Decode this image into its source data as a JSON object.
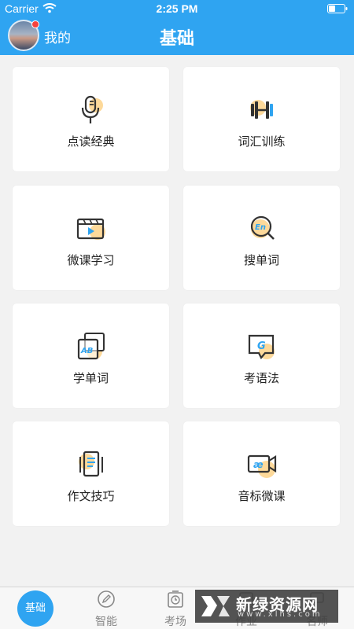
{
  "status_bar": {
    "carrier": "Carrier",
    "time": "2:25 PM"
  },
  "header": {
    "my_label": "我的",
    "title": "基础"
  },
  "cards": [
    {
      "label": "点读经典",
      "icon": "microphone-icon"
    },
    {
      "label": "词汇训练",
      "icon": "dumbbell-icon"
    },
    {
      "label": "微课学习",
      "icon": "video-player-icon"
    },
    {
      "label": "搜单词",
      "icon": "search-en-icon"
    },
    {
      "label": "学单词",
      "icon": "ab-cards-icon"
    },
    {
      "label": "考语法",
      "icon": "g-chat-icon"
    },
    {
      "label": "作文技巧",
      "icon": "document-icon"
    },
    {
      "label": "音标微课",
      "icon": "phonetic-camera-icon"
    }
  ],
  "tabbar": {
    "active": "基础",
    "tabs": [
      {
        "label": "智能",
        "icon": "pencil-circle-icon"
      },
      {
        "label": "考场",
        "icon": "clock-board-icon"
      },
      {
        "label": "作业",
        "icon": "homework-icon"
      },
      {
        "label": "名师",
        "icon": "teacher-icon"
      }
    ]
  },
  "watermark": {
    "text": "新绿资源网",
    "url": "www.xlhs.com"
  },
  "colors": {
    "primary": "#2fa4f1",
    "accent": "#fdd99a",
    "icon_stroke": "#333333",
    "badge": "#f4423d"
  }
}
